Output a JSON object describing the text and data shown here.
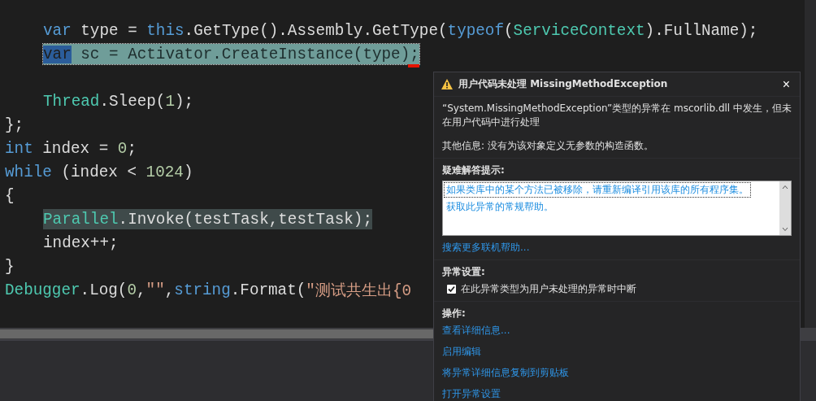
{
  "code_lines": [
    {
      "kind": "block",
      "children": [
        {
          "kind": "code",
          "error": false,
          "current": false,
          "tokens": [
            {
              "text": "var",
              "kind": "keyword",
              "selected": false
            },
            {
              "text": " type = ",
              "kind": "plain",
              "selected": false
            },
            {
              "text": "this",
              "kind": "keyword",
              "selected": false
            },
            {
              "text": ".GetType().Assembly.GetType(",
              "kind": "plain",
              "selected": false
            },
            {
              "text": "typeof",
              "kind": "keyword",
              "selected": false
            },
            {
              "text": "(",
              "kind": "plain",
              "selected": false
            },
            {
              "text": "ServiceContext",
              "kind": "type",
              "selected": false
            },
            {
              "text": ").FullName);",
              "kind": "plain",
              "selected": false
            }
          ]
        },
        {
          "kind": "code",
          "error": true,
          "current": false,
          "tokens": [
            {
              "text": "var",
              "kind": "keyword",
              "selected": true
            },
            {
              "text": " sc = Activator.CreateInstance(type);",
              "kind": "plain",
              "selected": false
            }
          ]
        },
        {
          "kind": "blank"
        },
        {
          "kind": "code",
          "error": false,
          "current": false,
          "tokens": [
            {
              "text": "Thread",
              "kind": "type",
              "selected": false
            },
            {
              "text": ".Sleep(",
              "kind": "plain",
              "selected": false
            },
            {
              "text": "1",
              "kind": "number",
              "selected": false
            },
            {
              "text": ");",
              "kind": "plain",
              "selected": false
            }
          ]
        }
      ]
    },
    {
      "kind": "code",
      "error": false,
      "current": false,
      "tokens": [
        {
          "text": "};",
          "kind": "plain",
          "selected": false
        }
      ]
    },
    {
      "kind": "code",
      "error": false,
      "current": false,
      "tokens": [
        {
          "text": "int",
          "kind": "keyword",
          "selected": false
        },
        {
          "text": " index = ",
          "kind": "plain",
          "selected": false
        },
        {
          "text": "0",
          "kind": "number",
          "selected": false
        },
        {
          "text": ";",
          "kind": "plain",
          "selected": false
        }
      ]
    },
    {
      "kind": "code",
      "error": false,
      "current": false,
      "tokens": [
        {
          "text": "while",
          "kind": "keyword",
          "selected": false
        },
        {
          "text": " (index < ",
          "kind": "plain",
          "selected": false
        },
        {
          "text": "1024",
          "kind": "number",
          "selected": false
        },
        {
          "text": ")",
          "kind": "plain",
          "selected": false
        }
      ]
    },
    {
      "kind": "code",
      "error": false,
      "current": false,
      "tokens": [
        {
          "text": "{",
          "kind": "plain",
          "selected": false
        }
      ],
      "children": [
        {
          "kind": "code",
          "error": false,
          "current": true,
          "tokens": [
            {
              "text": "Parallel",
              "kind": "type",
              "selected": false
            },
            {
              "text": ".Invoke(testTask,testTask);",
              "kind": "plain",
              "selected": false
            }
          ]
        },
        {
          "kind": "code",
          "error": false,
          "current": false,
          "tokens": [
            {
              "text": "index++;",
              "kind": "plain",
              "selected": false
            }
          ]
        }
      ]
    },
    {
      "kind": "code",
      "error": false,
      "current": false,
      "tokens": [
        {
          "text": "}",
          "kind": "plain",
          "selected": false
        }
      ]
    },
    {
      "kind": "code",
      "error": false,
      "current": false,
      "tokens": [
        {
          "text": "Debugger",
          "kind": "type",
          "selected": false
        },
        {
          "text": ".Log(",
          "kind": "plain",
          "selected": false
        },
        {
          "text": "0",
          "kind": "number",
          "selected": false
        },
        {
          "text": ",",
          "kind": "plain",
          "selected": false
        },
        {
          "text": "\"\"",
          "kind": "string",
          "selected": false
        },
        {
          "text": ",",
          "kind": "plain",
          "selected": false
        },
        {
          "text": "string",
          "kind": "keyword",
          "selected": false
        },
        {
          "text": ".Format(",
          "kind": "plain",
          "selected": false
        },
        {
          "text": "\"测试共生出{0",
          "kind": "string",
          "selected": false
        }
      ]
    }
  ],
  "exception_popup": {
    "title": "用户代码未处理 MissingMethodException",
    "close": "×",
    "message": "“System.MissingMethodException”类型的异常在 mscorlib.dll 中发生，但未在用户代码中进行处理",
    "additional_info": "其他信息: 没有为该对象定义无参数的构造函数。",
    "troubleshooting_heading": "疑难解答提示:",
    "tips": [
      {
        "text": "如果类库中的某个方法已被移除，请重新编译引用该库的所有程序集。",
        "selected": true
      },
      {
        "text": "获取此异常的常规帮助。",
        "selected": false
      }
    ],
    "online_help": "搜索更多联机帮助...",
    "settings_heading": "异常设置:",
    "break_option": {
      "label": "在此异常类型为用户未处理的异常时中断",
      "checked": true
    },
    "actions_heading": "操作:",
    "actions": [
      "查看详细信息...",
      "启用编辑",
      "将异常详细信息复制到剪贴板",
      "打开异常设置"
    ]
  }
}
